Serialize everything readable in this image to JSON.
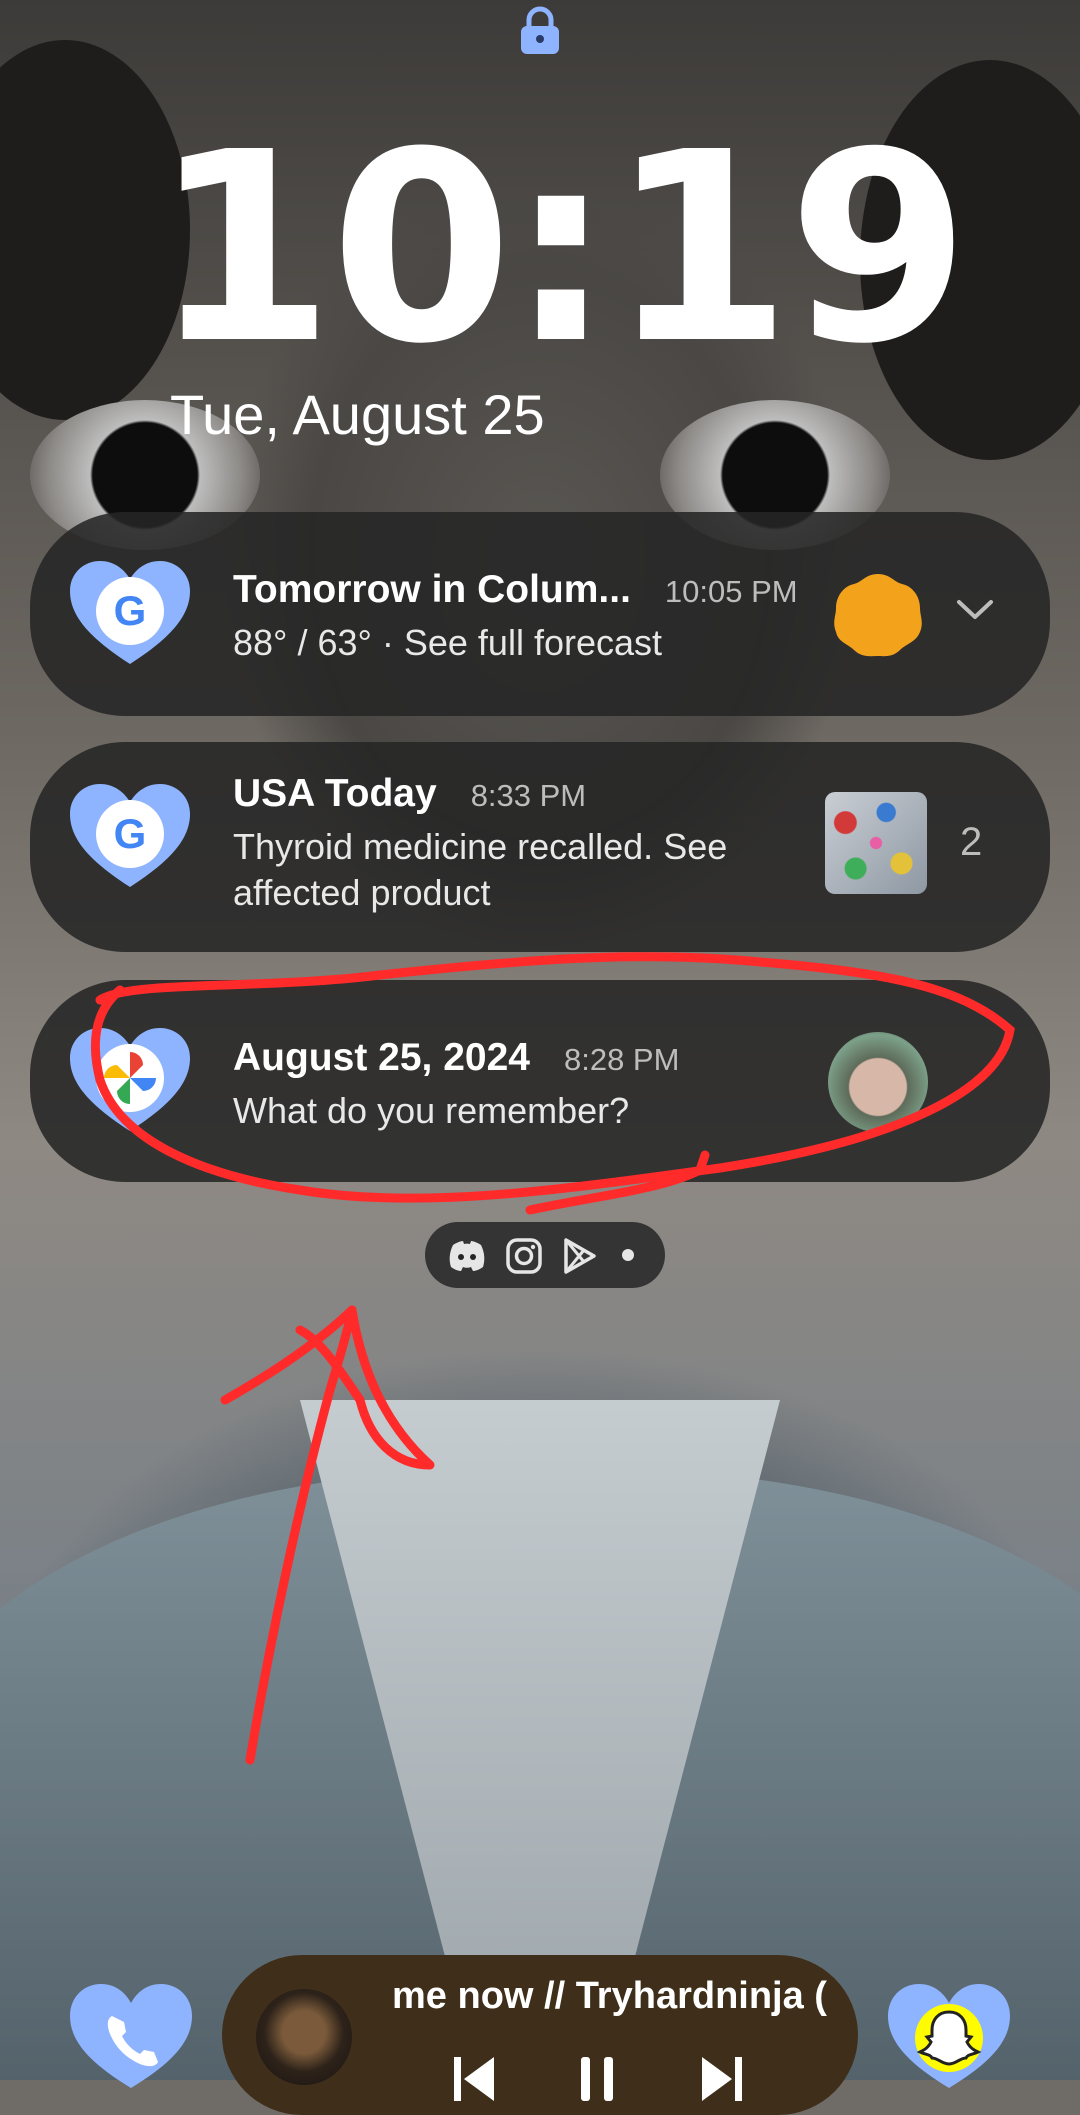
{
  "lockscreen": {
    "time": "10:19",
    "date": "Tue, August 25"
  },
  "notifications": [
    {
      "title": "Tomorrow in Colum...",
      "time": "10:05 PM",
      "body": "88° / 63° · See full forecast",
      "app_icon": "google-app-icon",
      "trailing": "sun-icon",
      "action_icon": "chevron-down-icon"
    },
    {
      "title": "USA Today",
      "time": "8:33 PM",
      "body": "Thyroid medicine recalled. See affected product",
      "app_icon": "google-app-icon",
      "trailing": "pills-thumbnail",
      "count": "2"
    },
    {
      "title": "August 25, 2024",
      "time": "8:28 PM",
      "body": "What do you remember?",
      "app_icon": "google-photos-icon",
      "trailing": "memory-avatar"
    }
  ],
  "more_apps": [
    "discord-icon",
    "instagram-icon",
    "play-store-icon",
    "more-dot-icon"
  ],
  "media": {
    "title": "me now // Tryhardninja (",
    "controls": [
      "previous-icon",
      "pause-icon",
      "next-icon"
    ]
  },
  "shortcuts": [
    "phone-icon",
    "snapchat-icon"
  ],
  "colors": {
    "notification_bg": "#262626",
    "annotation_red": "#ff2b2b",
    "heart_blue": "#8fb4ff"
  }
}
